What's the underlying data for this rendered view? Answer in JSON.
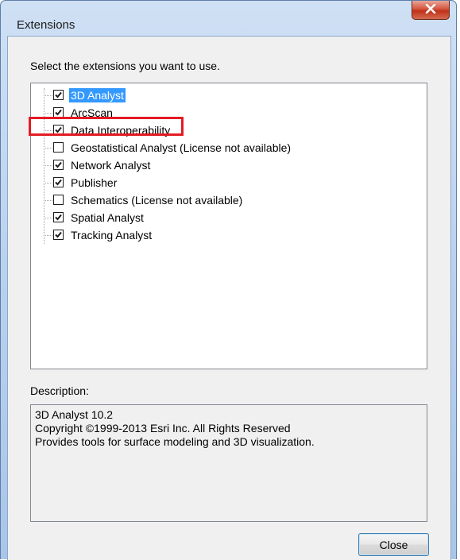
{
  "window": {
    "title": "Extensions",
    "close_glyph": "X"
  },
  "instructions": "Select the extensions you want to use.",
  "extensions": [
    {
      "label": "3D Analyst",
      "checked": true,
      "selected": true
    },
    {
      "label": "ArcScan",
      "checked": true,
      "selected": false
    },
    {
      "label": "Data Interoperability",
      "checked": true,
      "selected": false,
      "highlighted": true
    },
    {
      "label": "Geostatistical Analyst (License not available)",
      "checked": false,
      "selected": false
    },
    {
      "label": "Network Analyst",
      "checked": true,
      "selected": false
    },
    {
      "label": "Publisher",
      "checked": true,
      "selected": false
    },
    {
      "label": "Schematics (License not available)",
      "checked": false,
      "selected": false
    },
    {
      "label": "Spatial Analyst",
      "checked": true,
      "selected": false
    },
    {
      "label": "Tracking Analyst",
      "checked": true,
      "selected": false
    }
  ],
  "description": {
    "caption": "Description:",
    "lines": [
      "3D Analyst 10.2",
      "Copyright ©1999-2013 Esri Inc. All Rights Reserved",
      "",
      "Provides tools for surface modeling and 3D visualization."
    ]
  },
  "buttons": {
    "close_label": "Close"
  },
  "colors": {
    "selection": "#3399ff",
    "highlight_box": "#e31b23",
    "title_close": "#c0311a"
  }
}
